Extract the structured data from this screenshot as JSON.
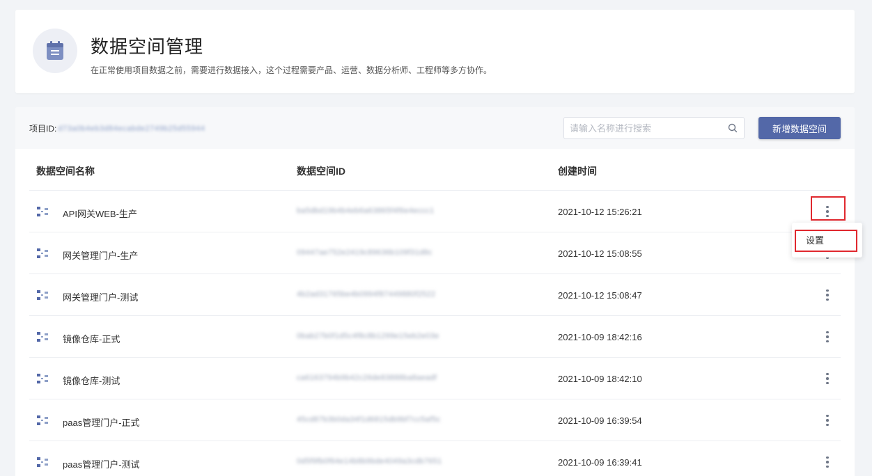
{
  "header": {
    "title": "数据空间管理",
    "description": "在正常使用项目数据之前，需要进行数据接入，这个过程需要产品、运营、数据分析师、工程师等多方协作。",
    "icon": "calendar-icon"
  },
  "toolbar": {
    "project_id_label": "项目ID:",
    "project_id_value": "d73a0b4eb3d84ecabde2749b25d55944",
    "search_placeholder": "请输入名称进行搜索",
    "add_button_label": "新增数据空间"
  },
  "table": {
    "columns": [
      "数据空间名称",
      "数据空间ID",
      "创建时间"
    ],
    "rows": [
      {
        "name": "API网关WEB-生产",
        "id": "ba5dbd19b4b4eb6a63865f4f6e4eccc1",
        "time": "2021-10-12 15:26:21"
      },
      {
        "name": "网关管理门户-生产",
        "id": "09447ae752e2419c89636b109f31d8c",
        "time": "2021-10-12 15:08:55"
      },
      {
        "name": "网关管理门户-测试",
        "id": "4b2ad31765be4b0994f87449880f2522",
        "time": "2021-10-12 15:08:47"
      },
      {
        "name": "镜像仓库-正式",
        "id": "0bab27b0f1d5c4f8c8b1299e15eb2e03e",
        "time": "2021-10-09 18:42:16"
      },
      {
        "name": "镜像仓库-测试",
        "id": "ca6163794b9b42c26de83888ba8aeadf",
        "time": "2021-10-09 18:42:10"
      },
      {
        "name": "paas管理门户-正式",
        "id": "45cd87b3b0da34f1d6815db9bf7cc5af5c",
        "time": "2021-10-09 16:39:54"
      },
      {
        "name": "paas管理门户-测试",
        "id": "0d5f9fb0f64e14b8b9bde4049a3cdb7651",
        "time": "2021-10-09 16:39:41"
      }
    ]
  },
  "dropdown": {
    "settings_label": "设置"
  },
  "colors": {
    "primary": "#5368a8",
    "highlight": "#e0282e",
    "background": "#f2f4f7"
  }
}
